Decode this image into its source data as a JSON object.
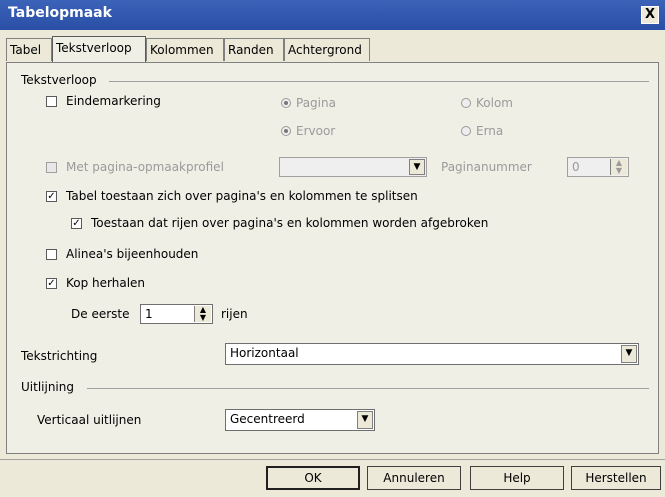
{
  "window": {
    "title": "Tabelopmaak",
    "close": "X"
  },
  "tabs": [
    "Tabel",
    "Tekstverloop",
    "Kolommen",
    "Randen",
    "Achtergrond"
  ],
  "tekstverloop": {
    "group_label": "Tekstverloop",
    "eindemarkering": "Eindemarkering",
    "radio_pagina": "Pagina",
    "radio_kolom": "Kolom",
    "radio_ervoor": "Ervoor",
    "radio_erna": "Erna",
    "met_paginaopmaak": "Met pagina-opmaakprofiel",
    "paginaopmaak_value": "",
    "paginanummer_label": "Paginanummer",
    "paginanummer_value": "0",
    "tabel_splitsen": "Tabel toestaan zich over pagina's en kolommen te splitsen",
    "rijen_afbreken": "Toestaan dat rijen over pagina's en kolommen worden afgebroken",
    "alinea_bijeen": "Alinea's bijeenhouden",
    "kop_herhalen": "Kop herhalen",
    "de_eerste": "De eerste",
    "rijen_value": "1",
    "rijen_label": "rijen",
    "tekstrichting_label": "Tekstrichting",
    "tekstrichting_value": "Horizontaal"
  },
  "uitlijning": {
    "group_label": "Uitlijning",
    "verticaal_label": "Verticaal uitlijnen",
    "verticaal_value": "Gecentreerd"
  },
  "buttons": {
    "ok": "OK",
    "annuleren": "Annuleren",
    "help": "Help",
    "herstellen": "Herstellen"
  },
  "glyphs": {
    "check": "✓",
    "arrow_down": "▼",
    "spin_up": "▲",
    "spin_down": "▼"
  }
}
